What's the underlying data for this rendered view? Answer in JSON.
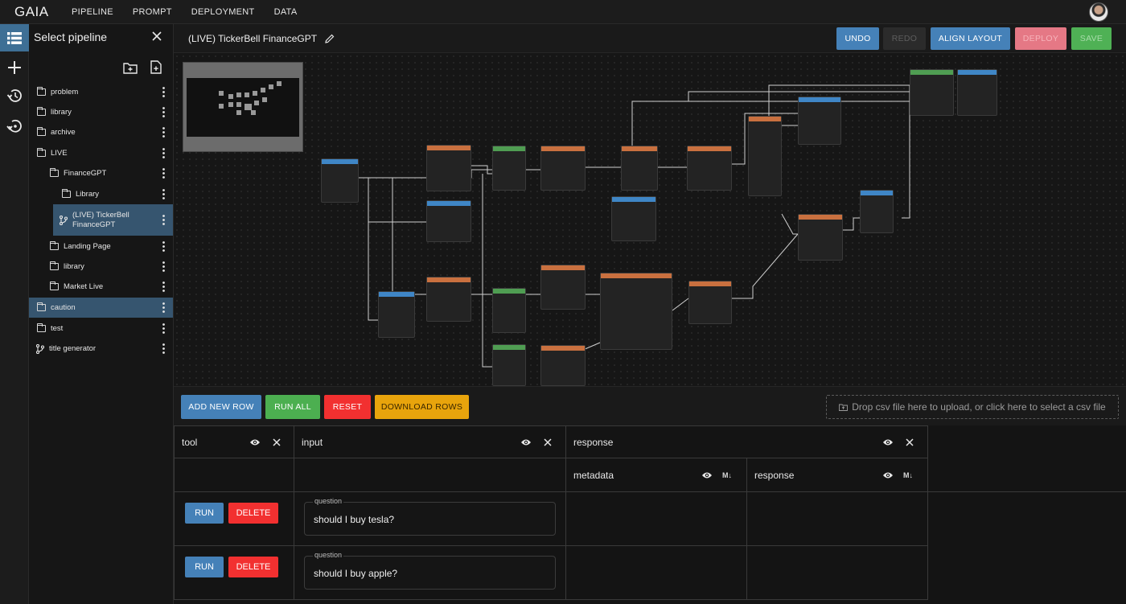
{
  "app": {
    "brand": "GAIA",
    "nav": [
      "PIPELINE",
      "PROMPT",
      "DEPLOYMENT",
      "DATA"
    ]
  },
  "sidebar": {
    "title": "Select pipeline",
    "items": [
      {
        "label": "problem",
        "icon": "folder-icon"
      },
      {
        "label": "library",
        "icon": "folder-icon"
      },
      {
        "label": "archive",
        "icon": "folder-icon"
      },
      {
        "label": "LIVE",
        "icon": "folder-open-icon"
      },
      {
        "label": "FinanceGPT",
        "icon": "folder-open-icon"
      },
      {
        "label": "Library",
        "icon": "folder-icon"
      },
      {
        "label": "(LIVE) TickerBell FinanceGPT",
        "icon": "branch-icon"
      },
      {
        "label": "Landing Page",
        "icon": "folder-icon"
      },
      {
        "label": "library",
        "icon": "folder-icon"
      },
      {
        "label": "Market Live",
        "icon": "folder-icon"
      },
      {
        "label": "caution",
        "icon": "folder-open-icon"
      },
      {
        "label": "test",
        "icon": "folder-icon"
      },
      {
        "label": "title generator",
        "icon": "branch-icon"
      }
    ]
  },
  "header": {
    "pipeline_title": "(LIVE) TickerBell FinanceGPT",
    "undo": "UNDO",
    "redo": "REDO",
    "align_layout": "ALIGN LAYOUT",
    "deploy": "DEPLOY",
    "save": "SAVE"
  },
  "runbar": {
    "add_row": "ADD NEW ROW",
    "run_all": "RUN ALL",
    "reset": "RESET",
    "download": "DOWNLOAD ROWS",
    "dropzone": "Drop csv file here to upload, or click here to select a csv file"
  },
  "table": {
    "columns": {
      "tool": "tool",
      "input": "input",
      "response": "response",
      "metadata": "metadata",
      "response_sub": "response",
      "md_badge": "M↓"
    },
    "rows": [
      {
        "run": "RUN",
        "delete": "DELETE",
        "question_label": "question",
        "question": "should I buy tesla?"
      },
      {
        "run": "RUN",
        "delete": "DELETE",
        "question_label": "question",
        "question": "should I buy apple?"
      }
    ]
  },
  "colors": {
    "accent_blue": "#4581b8",
    "run_green": "#4caf50",
    "danger_red": "#f23030",
    "download_amber": "#e8a40c",
    "selected_item": "#36556f"
  }
}
